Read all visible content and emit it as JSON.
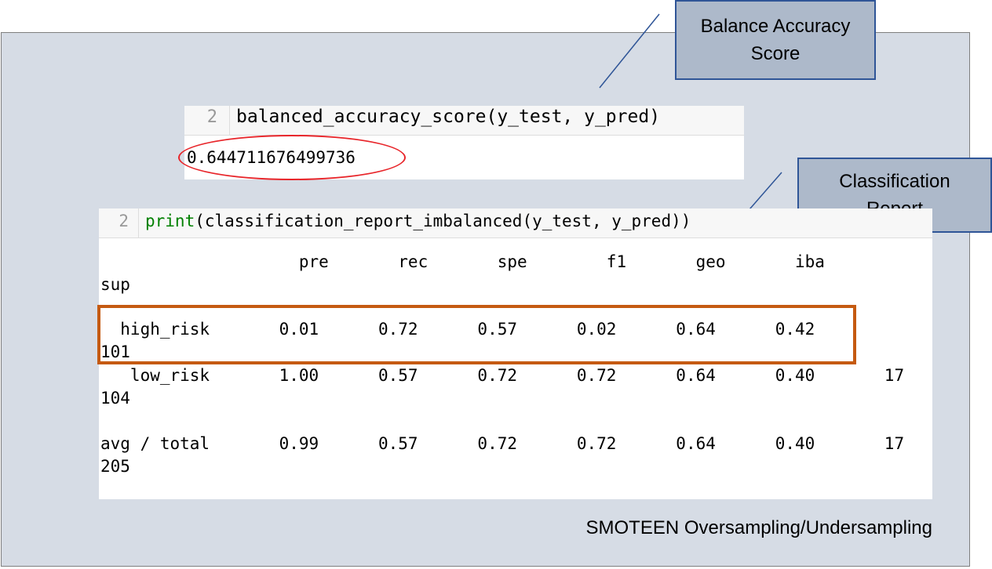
{
  "callouts": {
    "balance_accuracy": [
      "Balance Accuracy",
      "Score"
    ],
    "classification_report": [
      "Classification",
      "Report"
    ]
  },
  "cell1": {
    "line_number": "2",
    "code": "balanced_accuracy_score(y_test, y_pred)",
    "output": "0.644711676499736"
  },
  "cell2": {
    "line_number": "2",
    "code_kw": "print",
    "code_rest": "(classification_report_imbalanced(y_test, y_pred))",
    "header_line": "                    pre       rec       spe        f1       geo       iba",
    "header_wrap": "sup",
    "rows": [
      {
        "line": "  high_risk       0.01      0.72      0.57      0.02      0.64      0.42",
        "wrap": "101"
      },
      {
        "line": "   low_risk       1.00      0.57      0.72      0.72      0.64      0.40       17",
        "wrap": "104"
      },
      {
        "line": "avg / total       0.99      0.57      0.72      0.72      0.64      0.40       17",
        "wrap": "205"
      }
    ]
  },
  "caption": "SMOTEEN Oversampling/Undersampling",
  "colors": {
    "panel_bg": "#d6dce5",
    "callout_bg": "#adb9ca",
    "callout_border": "#2f5597",
    "ellipse": "#e8252a",
    "highlight_box": "#c55a11",
    "print_keyword": "#008000"
  }
}
